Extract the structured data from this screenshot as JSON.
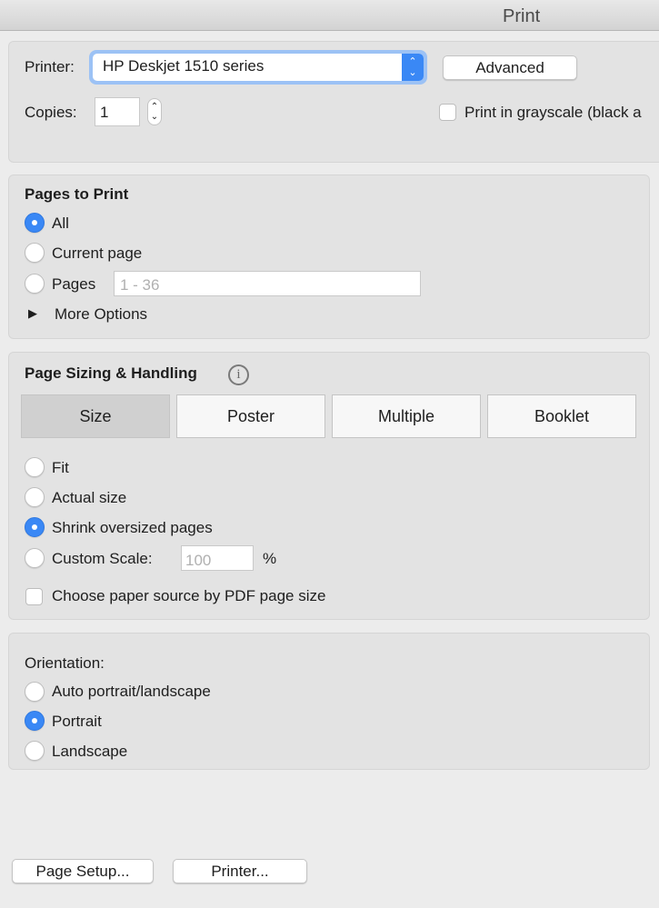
{
  "window": {
    "title": "Print"
  },
  "printer": {
    "label": "Printer:",
    "value": "HP Deskjet 1510 series",
    "advanced": "Advanced",
    "copies_label": "Copies:",
    "copies": "1",
    "grayscale": "Print in grayscale (black a",
    "grayscale_checked": false
  },
  "pages": {
    "heading": "Pages to Print",
    "all": "All",
    "current": "Current page",
    "pages": "Pages",
    "range_placeholder": "1 - 36",
    "more": "More Options",
    "selected": "All"
  },
  "sizing": {
    "heading": "Page Sizing & Handling",
    "tabs": [
      "Size",
      "Poster",
      "Multiple",
      "Booklet"
    ],
    "active_tab": "Size",
    "fit": "Fit",
    "actual": "Actual size",
    "shrink": "Shrink oversized pages",
    "custom": "Custom Scale:",
    "scale_placeholder": "100",
    "percent": "%",
    "paper_source": "Choose paper source by PDF page size",
    "selected": "Shrink oversized pages"
  },
  "orientation": {
    "heading": "Orientation:",
    "auto": "Auto portrait/landscape",
    "portrait": "Portrait",
    "landscape": "Landscape",
    "selected": "Portrait"
  },
  "footer": {
    "page_setup": "Page Setup...",
    "printer": "Printer..."
  },
  "colors": {
    "accent": "#3a88f5"
  }
}
